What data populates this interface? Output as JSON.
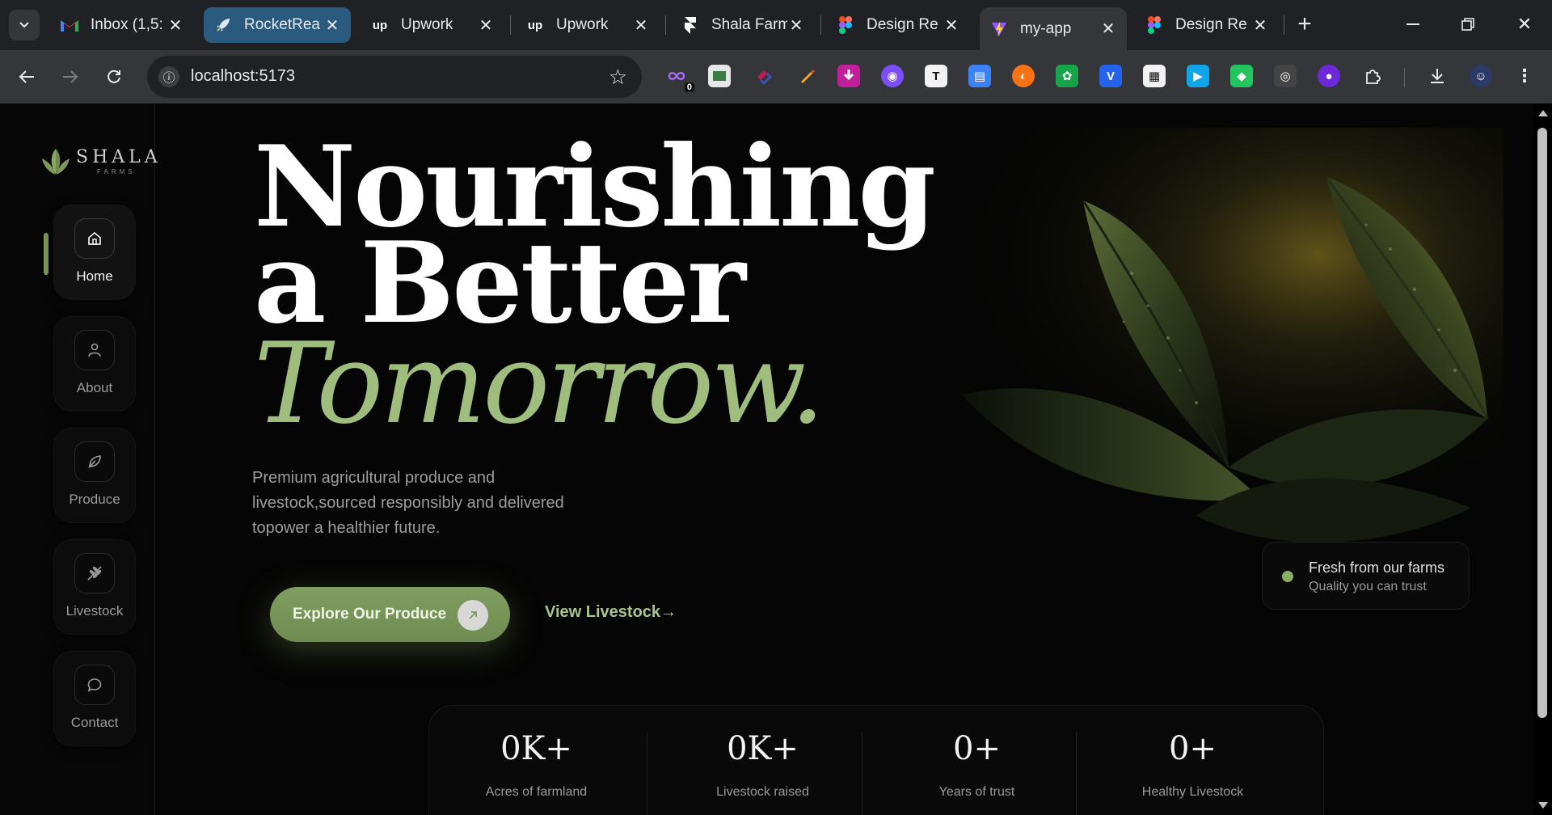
{
  "browser": {
    "tabs": [
      {
        "title": "Inbox (1,5:",
        "favicon": "gmail-icon"
      },
      {
        "title": "RocketRea",
        "favicon": "rocket-icon"
      },
      {
        "title": "Upwork",
        "favicon": "upwork-icon"
      },
      {
        "title": "Upwork",
        "favicon": "upwork-icon"
      },
      {
        "title": "Shala Farm",
        "favicon": "framer-icon"
      },
      {
        "title": "Design Re",
        "favicon": "figma-icon"
      },
      {
        "title": "my-app",
        "favicon": "vite-icon"
      },
      {
        "title": "Design Re",
        "favicon": "figma-icon"
      }
    ],
    "active_tab": "my-app",
    "url": "localhost:5173",
    "extension_badge": "0"
  },
  "brand": {
    "name": "SHALA",
    "sub": "FARMS"
  },
  "nav": [
    {
      "label": "Home",
      "icon": "home-icon",
      "active": true
    },
    {
      "label": "About",
      "icon": "user-icon",
      "active": false
    },
    {
      "label": "Produce",
      "icon": "leaf-icon",
      "active": false
    },
    {
      "label": "Livestock",
      "icon": "wheat-icon",
      "active": false
    },
    {
      "label": "Contact",
      "icon": "chat-icon",
      "active": false
    }
  ],
  "hero": {
    "line1": "Nourishing",
    "line2": "a Better",
    "line3": "Tomorrow.",
    "description": "Premium agricultural produce and livestock,sourced responsibly and delivered topower a healthier future.",
    "primary_cta": "Explore Our Produce",
    "secondary_cta": "View Livestock→"
  },
  "badge": {
    "title": "Fresh from our farms",
    "subtitle": "Quality you can trust"
  },
  "stats": [
    {
      "value": "0K+",
      "label": "Acres of farmland"
    },
    {
      "value": "0K+",
      "label": "Livestock raised"
    },
    {
      "value": "0+",
      "label": "Years of trust"
    },
    {
      "value": "0+",
      "label": "Healthy Livestock"
    }
  ],
  "colors": {
    "accent": "#9fbe7e",
    "button": "#7a9a5c",
    "background": "#050505"
  }
}
